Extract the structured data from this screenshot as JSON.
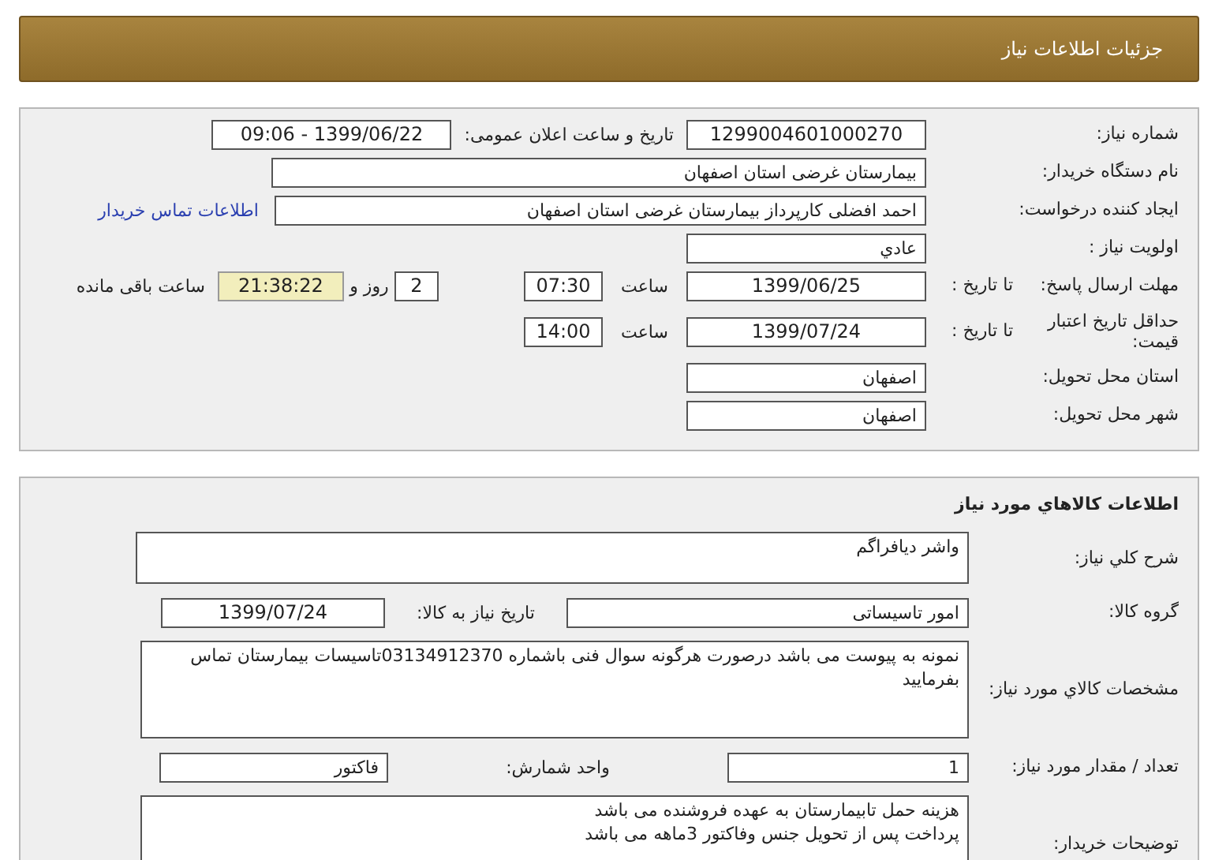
{
  "header": {
    "title": "جزئیات اطلاعات نیاز"
  },
  "need": {
    "number": {
      "label": "شماره نیاز:",
      "value": "1299004601000270"
    },
    "announce": {
      "label": "تاریخ و ساعت اعلان عمومی:",
      "value": "1399/06/22 - 09:06"
    },
    "buyer_org": {
      "label": "نام دستگاه خریدار:",
      "value": "بیمارستان غرضی استان اصفهان"
    },
    "requester": {
      "label": "ایجاد کننده درخواست:",
      "value": "احمد افضلی کارپرداز بیمارستان غرضی استان اصفهان",
      "link": "اطلاعات تماس خریدار"
    },
    "priority": {
      "label": "اولویت نیاز :",
      "value": "عادي"
    },
    "deadline": {
      "label": "مهلت ارسال پاسخ:",
      "sublabel": "تا تاریخ :",
      "date": "1399/06/25",
      "time_label": "ساعت",
      "time": "07:30",
      "days": "2",
      "days_label": "روز و",
      "remaining": "21:38:22",
      "remaining_label": "ساعت باقی مانده"
    },
    "validity": {
      "label": "حداقل تاریخ اعتبار قیمت:",
      "sublabel": "تا تاریخ :",
      "date": "1399/07/24",
      "time_label": "ساعت",
      "time": "14:00"
    },
    "province": {
      "label": "استان محل تحویل:",
      "value": "اصفهان"
    },
    "city": {
      "label": "شهر محل تحویل:",
      "value": "اصفهان"
    }
  },
  "goods": {
    "title": "اطلاعات كالاهاي مورد نياز",
    "description": {
      "label": "شرح كلي نياز:",
      "value": "واشر دیافراگم"
    },
    "group": {
      "label": "گروه كالا:",
      "value": "امور تاسیساتی",
      "date_label": "تاريخ نياز به كالا:",
      "date": "1399/07/24"
    },
    "specs": {
      "label": "مشخصات كالاي مورد نياز:",
      "value": "نمونه به پیوست می باشد درصورت هرگونه سوال فنی باشماره 03134912370تاسیسات بیمارستان تماس بفرمایید"
    },
    "quantity": {
      "label": "تعداد / مقدار مورد نیاز:",
      "value": "1",
      "unit_label": "واحد شمارش:",
      "unit": "فاکتور"
    },
    "notes": {
      "label": "توضیحات خریدار:",
      "lines": [
        "هزینه حمل تابیمارستان به عهده فروشنده می باشد",
        "پرداخت پس از تحویل جنس وفاکتور 3ماهه می باشد"
      ]
    }
  }
}
